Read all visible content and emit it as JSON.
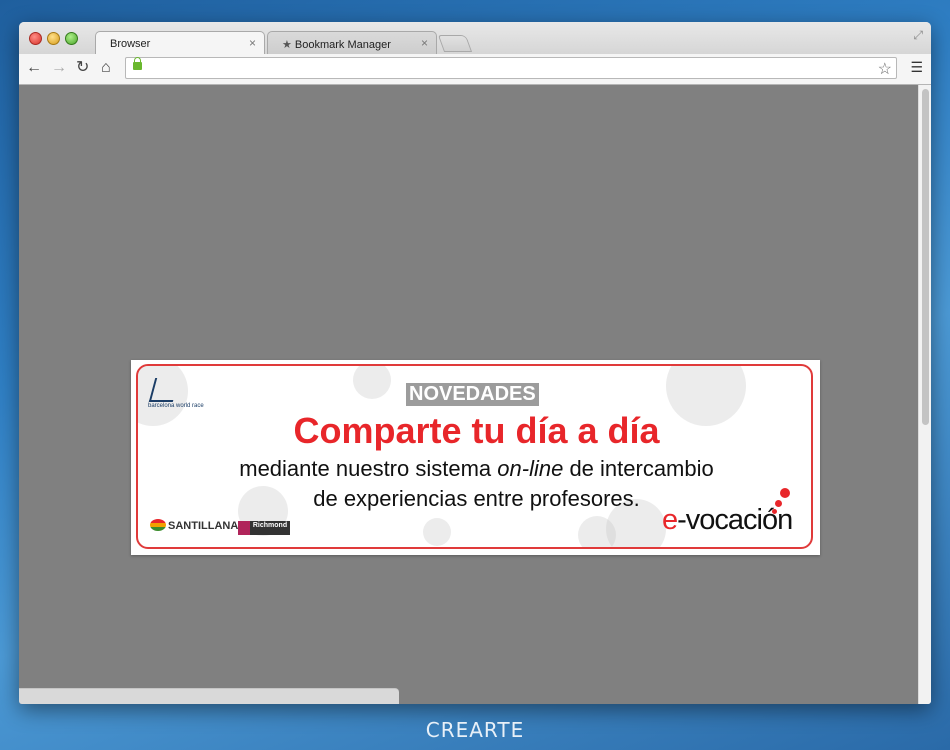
{
  "browser": {
    "tabs": [
      {
        "label": "Browser",
        "active": true
      },
      {
        "label": "Bookmark Manager",
        "icon": "star-icon",
        "active": false
      }
    ],
    "close_glyph": "×",
    "url": ""
  },
  "banner": {
    "badge": "NOVEDADES",
    "headline": "Comparte tu día a día",
    "line1_pre": "mediante nuestro sistema ",
    "line1_em": "on-line",
    "line1_post": " de intercambio",
    "line2": "de experiencias entre profesores.",
    "logo_top_left": "barcelona world race",
    "logo_santillana": "SANTILLANA",
    "logo_richmond": "Richmond",
    "logo_evocacion_e": "e",
    "logo_evocacion_rest": "-vocación",
    "accent": "#e8262a"
  },
  "desktop": {
    "watermark": "CREARTE"
  }
}
